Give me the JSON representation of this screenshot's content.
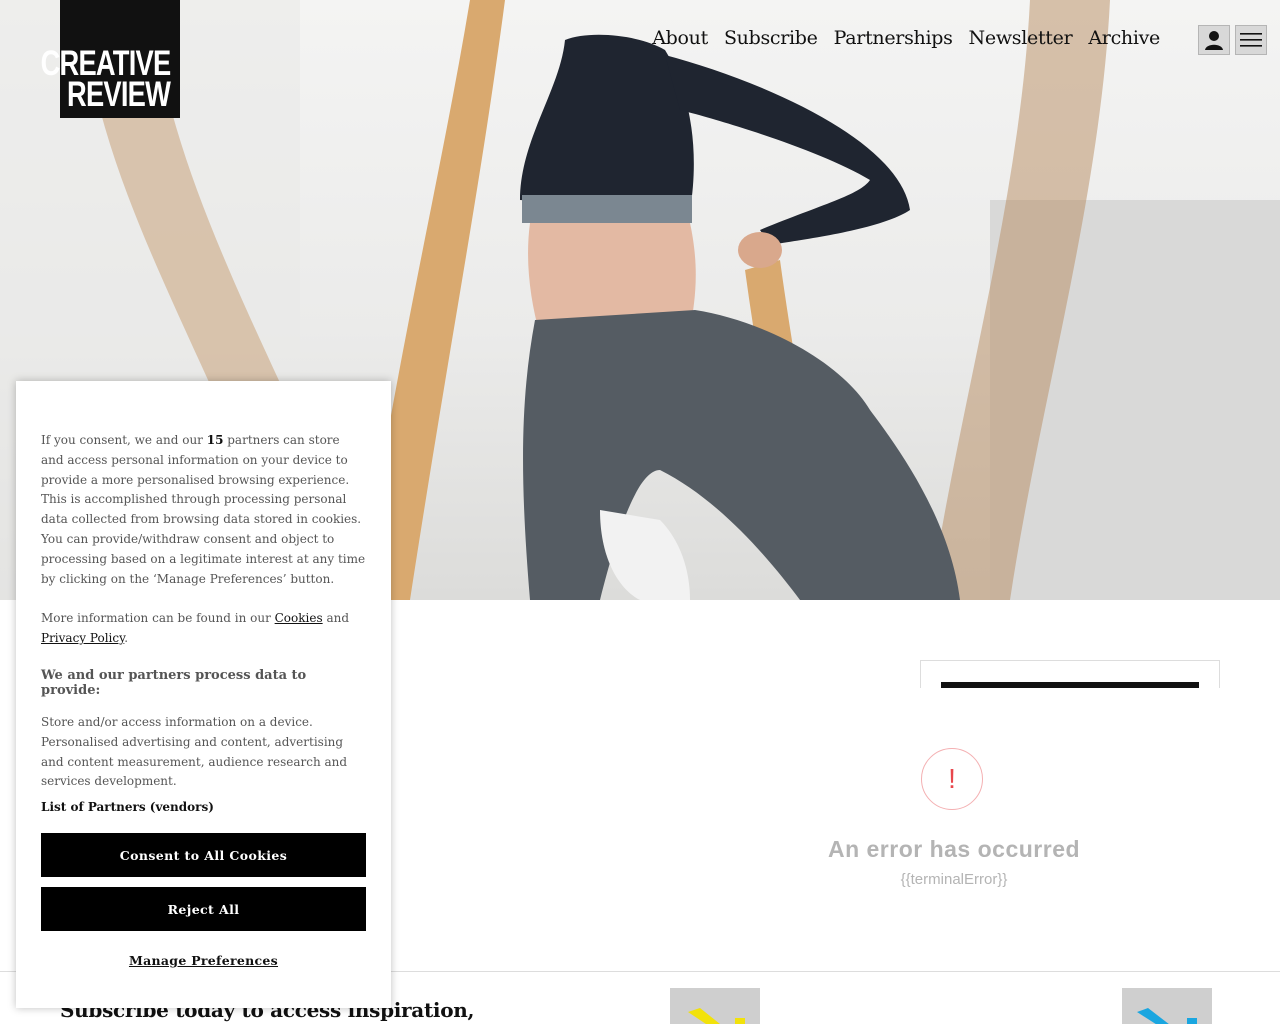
{
  "brand": {
    "line1": "CREATIVE",
    "line2": "REVIEW"
  },
  "nav": {
    "items": [
      {
        "label": "About"
      },
      {
        "label": "Subscribe"
      },
      {
        "label": "Partnerships"
      },
      {
        "label": "Newsletter"
      },
      {
        "label": "Archive"
      }
    ]
  },
  "icons": {
    "account": "user-icon",
    "menu": "hamburger-menu-icon",
    "error": "exclamation-icon"
  },
  "consent": {
    "intro_before": "If you consent, we and our ",
    "partner_count": "15",
    "intro_after": " partners can store and access personal information on your device to provide a more personalised browsing experience. This is accomplished through processing personal data collected from browsing data stored in cookies. You can provide/withdraw consent and object to processing based on a legitimate interest at any time by clicking on the ‘Manage Preferences’ button.",
    "more_before": "More information can be found in our ",
    "cookies_link": "Cookies",
    "more_and": " and ",
    "privacy_link": "Privacy Policy",
    "more_end": ".",
    "heading": "We and our partners process data to provide:",
    "purposes": "Store and/or access information on a device. Personalised advertising and content, advertising and content measurement, audience research and services development.",
    "vendors_link": "List of Partners (vendors)",
    "consent_button": "Consent to All Cookies",
    "reject_button": "Reject All",
    "manage_button": "Manage Preferences"
  },
  "error": {
    "icon_glyph": "!",
    "title": "An error has occurred",
    "detail": "{{terminalError}}"
  },
  "footer": {
    "subscribe_heading": "Subscribe today to access inspiration,"
  },
  "colors": {
    "error_red": "#e8474d",
    "brand_black": "#111111",
    "thumb_yellow": "#f2e20a",
    "thumb_blue": "#1aa6e0"
  }
}
